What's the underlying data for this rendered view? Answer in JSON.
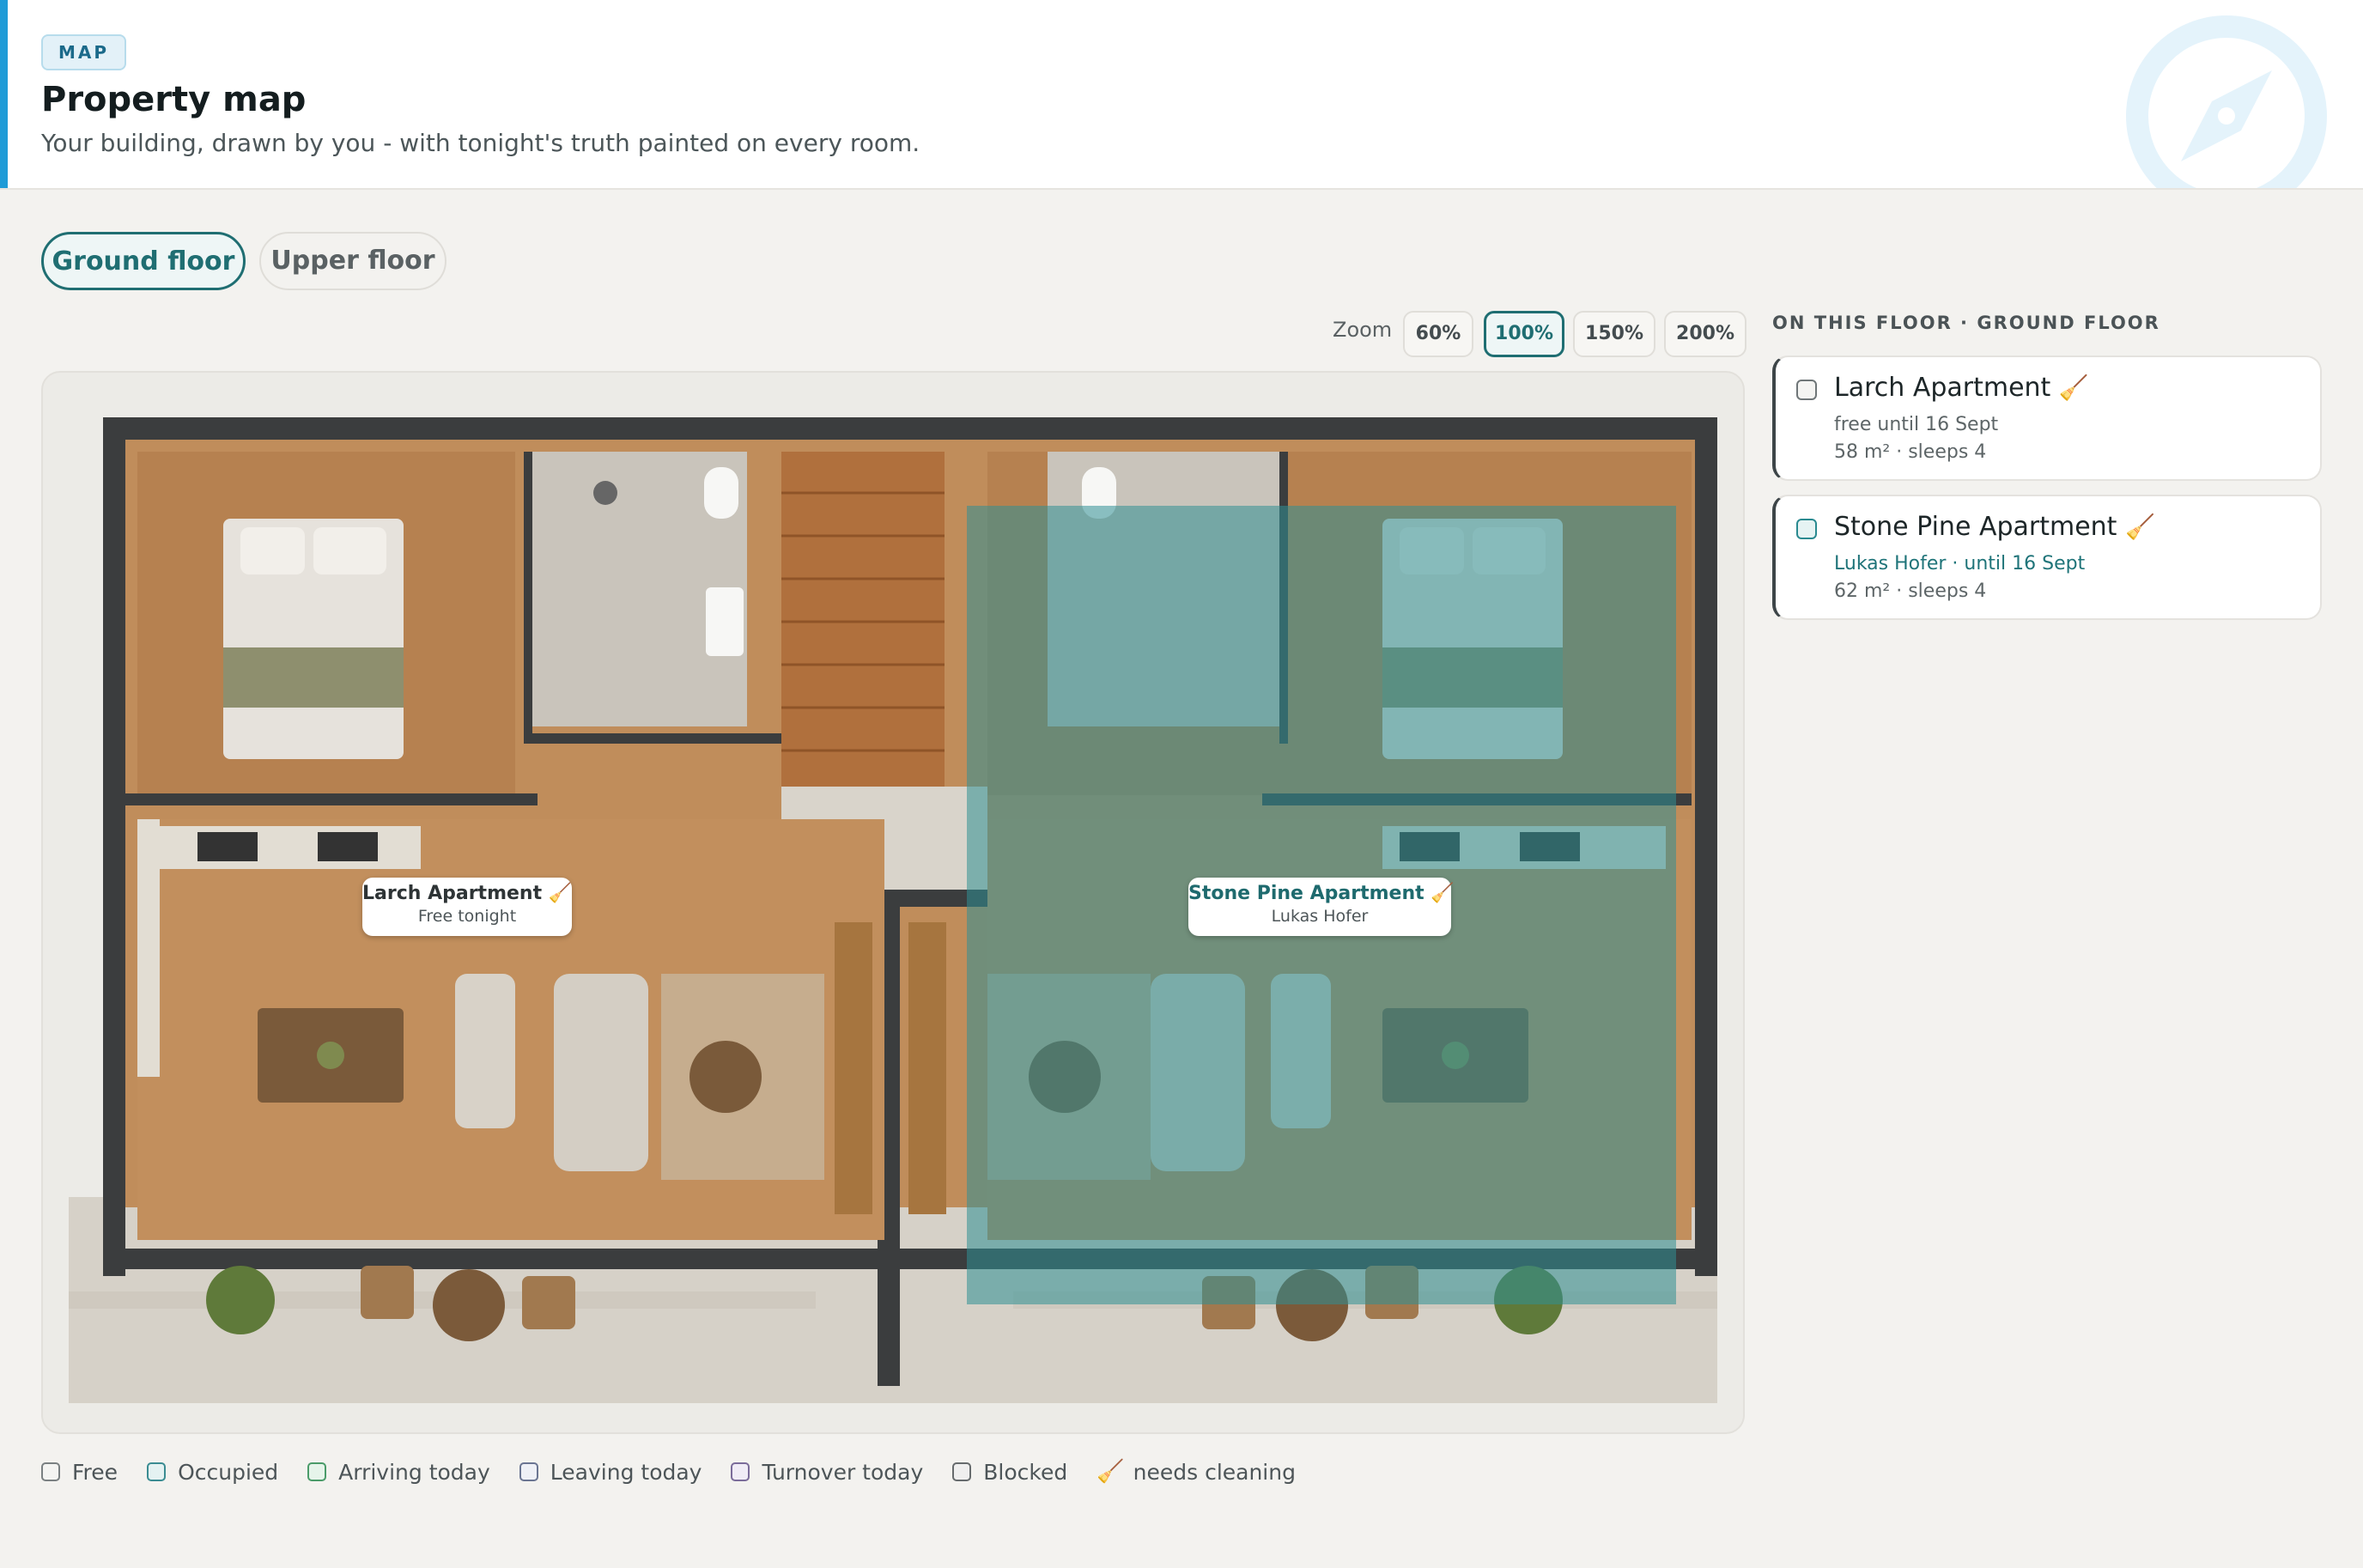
{
  "header": {
    "badge": "MAP",
    "title": "Property map",
    "subtitle": "Your building, drawn by you - with tonight's truth painted on every room.",
    "icon": "compass-icon"
  },
  "floors": {
    "active": "Ground floor",
    "inactive": "Upper floor"
  },
  "zoom": {
    "label": "Zoom",
    "options": [
      "60%",
      "100%",
      "150%",
      "200%"
    ],
    "selected": "100%"
  },
  "map": {
    "labels": [
      {
        "name": "Larch Apartment",
        "sub": "Free tonight",
        "icon": "broom-icon"
      },
      {
        "name": "Stone Pine Apartment",
        "sub": "Lukas Hofer",
        "icon": "broom-icon"
      }
    ]
  },
  "sidebar": {
    "heading": "ON THIS FLOOR · GROUND FLOOR",
    "units": [
      {
        "name": "Larch Apartment",
        "status": "free until 16 Sept",
        "details": "58 m² · sleeps 4",
        "icon": "broom-icon"
      },
      {
        "name": "Stone Pine Apartment",
        "status": "Lukas Hofer · until 16 Sept",
        "details": "62 m² · sleeps 4",
        "icon": "broom-icon"
      }
    ]
  },
  "legend": [
    {
      "label": "Free",
      "color": "#f4f4f2",
      "border": "#7a8082"
    },
    {
      "label": "Occupied",
      "color": "#e4f2f2",
      "border": "#3a8c92"
    },
    {
      "label": "Arriving today",
      "color": "#e6f4ea",
      "border": "#4a9b69"
    },
    {
      "label": "Leaving today",
      "color": "#eef0f6",
      "border": "#6a7592"
    },
    {
      "label": "Turnover today",
      "color": "#f0ecf6",
      "border": "#7b6c9a"
    },
    {
      "label": "Blocked",
      "color": "#efefef",
      "border": "#666b6d"
    },
    {
      "label": "needs cleaning",
      "icon": "broom-icon"
    }
  ],
  "colors": {
    "accent": "#1e9bd7",
    "teal": "#1f6e72",
    "occupied_overlay": "#2f8f94"
  }
}
